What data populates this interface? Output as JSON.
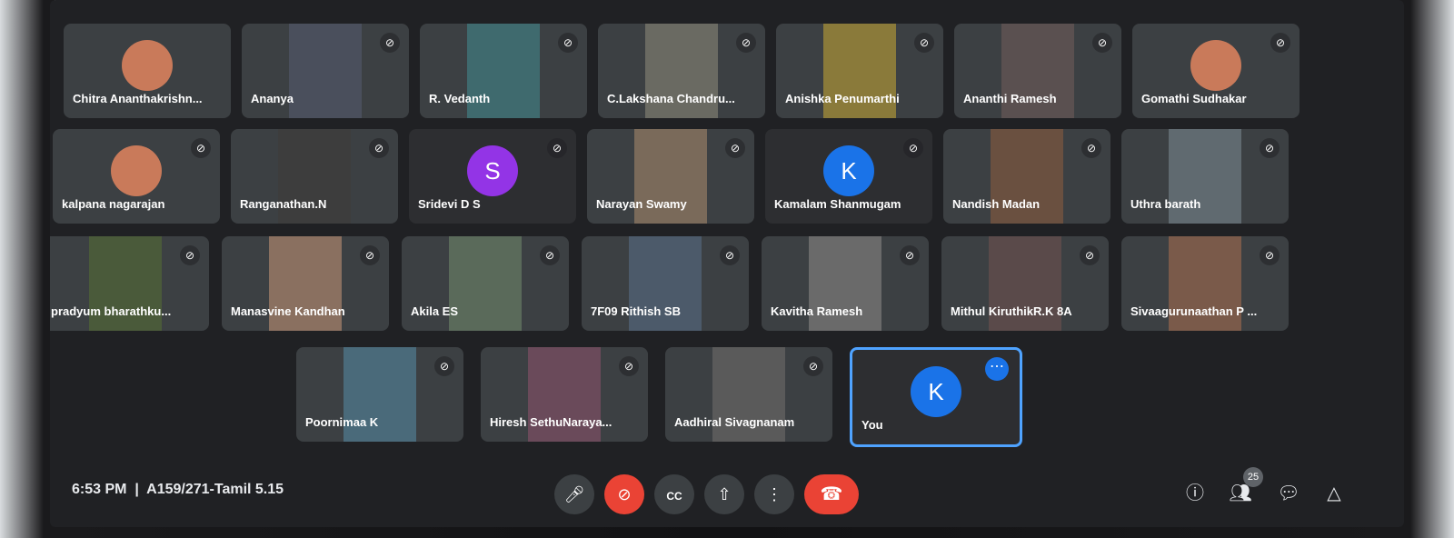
{
  "participants": [
    {
      "name": "Chitra Ananthakrishn...",
      "kind": "avatar-photo",
      "muted": false
    },
    {
      "name": "Ananya",
      "kind": "video",
      "muted": true
    },
    {
      "name": "R. Vedanth",
      "kind": "video",
      "muted": true
    },
    {
      "name": "C.Lakshana Chandru...",
      "kind": "video",
      "muted": true
    },
    {
      "name": "Anishka Penumarthi",
      "kind": "video",
      "muted": true
    },
    {
      "name": "Ananthi Ramesh",
      "kind": "video",
      "muted": true
    },
    {
      "name": "Gomathi Sudhakar",
      "kind": "avatar-photo",
      "muted": true
    },
    {
      "name": "kalpana nagarajan",
      "kind": "avatar-photo",
      "muted": true
    },
    {
      "name": "Ranganathan.N",
      "kind": "video",
      "muted": true
    },
    {
      "name": "Sridevi D S",
      "kind": "avatar",
      "initial": "S",
      "muted": true
    },
    {
      "name": "Narayan Swamy",
      "kind": "video",
      "muted": true
    },
    {
      "name": "Kamalam Shanmugam",
      "kind": "avatar",
      "initial": "K",
      "muted": true
    },
    {
      "name": "Nandish Madan",
      "kind": "video",
      "muted": true
    },
    {
      "name": "Uthra barath",
      "kind": "video",
      "muted": true
    },
    {
      "name": "pradyum bharathku...",
      "kind": "video",
      "muted": true
    },
    {
      "name": "Manasvine Kandhan",
      "kind": "video",
      "muted": true
    },
    {
      "name": "Akila ES",
      "kind": "video",
      "muted": true
    },
    {
      "name": "7F09 Rithish SB",
      "kind": "video",
      "muted": true
    },
    {
      "name": "Kavitha Ramesh",
      "kind": "video",
      "muted": true
    },
    {
      "name": "Mithul KiruthikR.K 8A",
      "kind": "video",
      "muted": true
    },
    {
      "name": "Sivaagurunaathan P ...",
      "kind": "video",
      "muted": true
    },
    {
      "name": "Poornimaa K",
      "kind": "video",
      "muted": true
    },
    {
      "name": "Hiresh SethuNarayа...",
      "kind": "video",
      "muted": true
    },
    {
      "name": "Aadhiral Sivagnanam",
      "kind": "video",
      "muted": true
    },
    {
      "name": "You",
      "kind": "self",
      "initial": "K",
      "muted": false
    }
  ],
  "footer": {
    "time": "6:53 PM",
    "separator": "|",
    "meeting_name": "A159/271-Tamil 5.15",
    "participant_count": "25"
  },
  "colors": {
    "accent": "#1a73e8",
    "end_call": "#ea4335",
    "self_avatar": "#1a73e8",
    "sridevi_avatar": "#9334e6",
    "kamalam_avatar": "#1a73e8"
  }
}
